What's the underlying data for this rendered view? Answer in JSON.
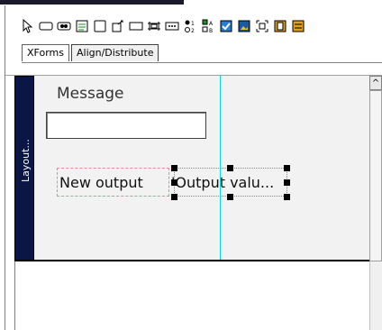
{
  "tabs": [
    {
      "label": "XForms",
      "active": true
    },
    {
      "label": "Align/Distribute",
      "active": false
    }
  ],
  "toolbar_icons": [
    "pointer-icon",
    "input-icon",
    "secret-icon",
    "textarea-icon",
    "output-icon",
    "upload-icon",
    "range-icon",
    "trigger-icon",
    "submit-icon",
    "select1-icon",
    "select-icon",
    "checkbox-icon",
    "image-icon",
    "group-icon",
    "switch-icon",
    "repeat-icon"
  ],
  "layout_label": "Layout...",
  "form": {
    "message_label": "Message",
    "message_value": "",
    "output_label": "New output",
    "output_value": "'Output valu..."
  },
  "scrollbar": {
    "up_arrow": "^"
  },
  "colors": {
    "layout_bar": "#0a1646",
    "guide_line": "#00e0e0",
    "dashed_border": "#e88a8a",
    "design_bg": "#f2f2f2"
  }
}
